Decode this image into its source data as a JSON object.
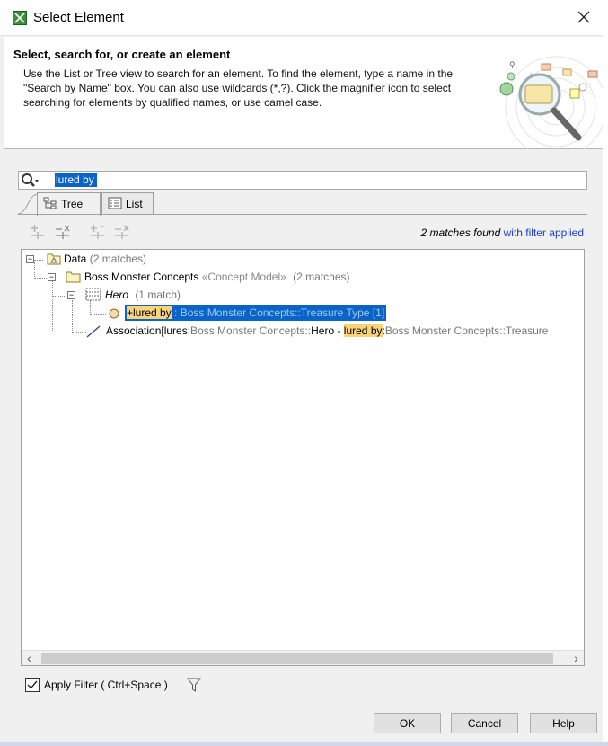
{
  "window": {
    "title": "Select Element"
  },
  "header": {
    "title": "Select, search for, or create an element",
    "description": "Use the List or Tree view to search for an element. To find the element, type a name in the \"Search by Name\" box. You can also use wildcards (*,?). Click the magnifier icon to select searching for elements by qualified names, or use camel case."
  },
  "search": {
    "value": "lured by"
  },
  "tabs": [
    {
      "label": "Tree",
      "active": true,
      "icon": "tree-icon"
    },
    {
      "label": "List",
      "active": false,
      "icon": "list-icon"
    }
  ],
  "toolbar": {
    "icons": [
      "expand-all-icon",
      "collapse-all-icon",
      "expand-selected-icon",
      "collapse-selected-icon"
    ]
  },
  "match_status": {
    "count_text": "2 matches found",
    "link_text": "with filter applied"
  },
  "tree": {
    "data": {
      "label": "Data",
      "matches": "(2 matches)",
      "icon": "package-icon"
    },
    "concept": {
      "label": "Boss Monster Concepts",
      "stereotype": "«Concept Model»",
      "matches": "(2 matches)",
      "icon": "folder-icon"
    },
    "hero": {
      "label": "Hero",
      "matches": "(1 match)",
      "icon": "class-icon"
    },
    "property": {
      "prefix": "+",
      "highlight": "lured by",
      "rest": " : Boss Monster Concepts::Treasure Type [1]",
      "icon": "property-icon"
    },
    "association": {
      "prefix": "Association[lures:",
      "path1": "Boss Monster Concepts::",
      "name1": "Hero - ",
      "highlight": "lured by",
      "sep": ":",
      "path2": "Boss Monster Concepts::Treasure",
      "icon": "association-icon"
    }
  },
  "filter": {
    "checked": true,
    "label": "Apply Filter ( Ctrl+Space )"
  },
  "buttons": {
    "ok": "OK",
    "cancel": "Cancel",
    "help": "Help"
  },
  "colors": {
    "selection": "#0a64c8",
    "highlight": "#f9d27a",
    "link": "#1a3cc8"
  }
}
